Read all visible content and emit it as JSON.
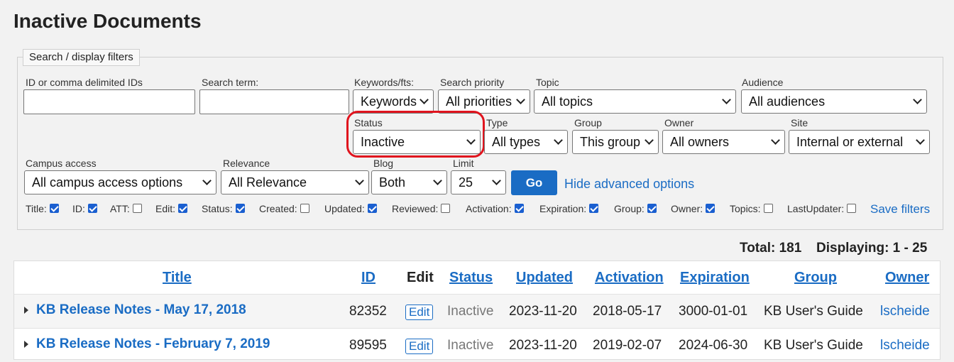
{
  "page_title": "Inactive Documents",
  "filters": {
    "legend": "Search / display filters",
    "id_label": "ID or comma delimited IDs",
    "id_value": "",
    "search_label": "Search term:",
    "search_value": "",
    "keywords_label": "Keywords/fts:",
    "keywords_value": "Keywords",
    "priority_label": "Search priority",
    "priority_value": "All priorities",
    "topic_label": "Topic",
    "topic_value": "All topics",
    "audience_label": "Audience",
    "audience_value": "All audiences",
    "status_label": "Status",
    "status_value": "Inactive",
    "type_label": "Type",
    "type_value": "All types",
    "group_label": "Group",
    "group_value": "This group",
    "owner_label": "Owner",
    "owner_value": "All owners",
    "site_label": "Site",
    "site_value": "Internal or external",
    "campus_label": "Campus access",
    "campus_value": "All campus access options",
    "relevance_label": "Relevance",
    "relevance_value": "All Relevance",
    "blog_label": "Blog",
    "blog_value": "Both",
    "limit_label": "Limit",
    "limit_value": "25",
    "go_label": "Go",
    "hide_advanced_label": "Hide advanced options",
    "save_filters_label": "Save filters"
  },
  "columns_toggle": [
    {
      "label": "Title:",
      "checked": true
    },
    {
      "label": "ID:",
      "checked": true
    },
    {
      "label": "ATT:",
      "checked": false
    },
    {
      "label": "Edit:",
      "checked": true
    },
    {
      "label": "Status:",
      "checked": true
    },
    {
      "label": "Created:",
      "checked": false
    },
    {
      "label": "Updated:",
      "checked": true
    },
    {
      "label": "Reviewed:",
      "checked": false
    },
    {
      "label": "Activation:",
      "checked": true
    },
    {
      "label": "Expiration:",
      "checked": true
    },
    {
      "label": "Group:",
      "checked": true
    },
    {
      "label": "Owner:",
      "checked": true
    },
    {
      "label": "Topics:",
      "checked": false
    },
    {
      "label": "LastUpdater:",
      "checked": false
    }
  ],
  "summary": {
    "total": "Total: 181",
    "displaying": "Displaying: 1 - 25"
  },
  "table": {
    "headers": {
      "title": "Title",
      "id": "ID",
      "edit": "Edit",
      "status": "Status",
      "updated": "Updated",
      "activation": "Activation",
      "expiration": "Expiration",
      "group": "Group",
      "owner": "Owner"
    },
    "rows": [
      {
        "title": "KB Release Notes - May 17, 2018",
        "id": "82352",
        "edit": "Edit",
        "status": "Inactive",
        "updated": "2023-11-20",
        "activation": "2018-05-17",
        "expiration": "3000-01-01",
        "group": "KB User's Guide",
        "owner": "lscheide"
      },
      {
        "title": "KB Release Notes - February 7, 2019",
        "id": "89595",
        "edit": "Edit",
        "status": "Inactive",
        "updated": "2023-11-20",
        "activation": "2019-02-07",
        "expiration": "2024-06-30",
        "group": "KB User's Guide",
        "owner": "lscheide"
      }
    ]
  },
  "colors": {
    "accent": "#1a6cc4",
    "highlight_ring": "#e0141e"
  }
}
